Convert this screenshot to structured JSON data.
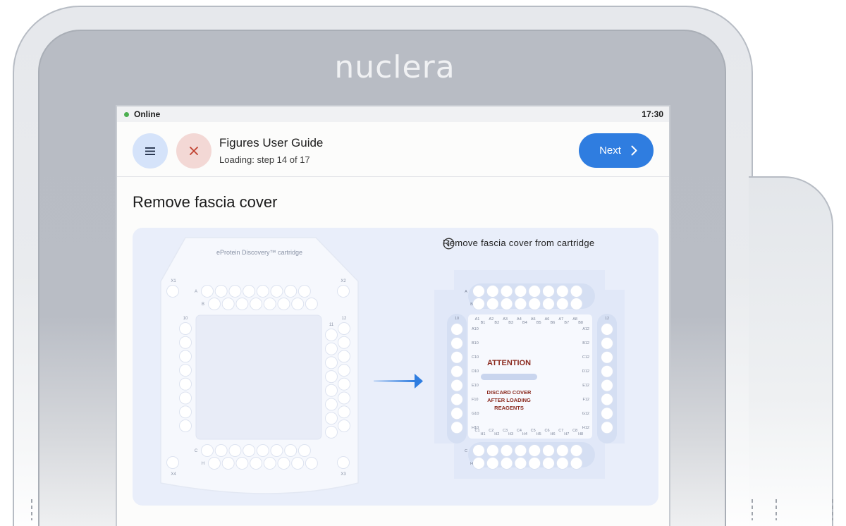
{
  "device": {
    "brand": "nuclera"
  },
  "status_bar": {
    "connection": "Online",
    "time": "17:30"
  },
  "header": {
    "title": "Figures User Guide",
    "subtitle": "Loading: step 14 of 17",
    "next_label": "Next",
    "menu_icon": "menu-icon",
    "close_icon": "close-icon"
  },
  "step": {
    "title": "Remove fascia cover"
  },
  "figure": {
    "caption": "Remove fascia cover from cartridge",
    "left_cartridge": {
      "label": "eProtein Discovery™ cartridge",
      "corner_labels": [
        "X1",
        "X2",
        "X3",
        "X4"
      ],
      "row_labels": [
        "A",
        "B",
        "C",
        "H"
      ],
      "column_labels": [
        "10",
        "11",
        "12"
      ]
    },
    "right_cartridge": {
      "row_labels": [
        "A",
        "B",
        "C",
        "H"
      ],
      "side_labels": [
        "10",
        "12"
      ],
      "top_wells": [
        "A1",
        "B1",
        "A2",
        "B2",
        "A3",
        "B3",
        "A4",
        "B4",
        "A5",
        "B5",
        "A6",
        "B6",
        "A7",
        "B7",
        "A8",
        "B8"
      ],
      "left_wells": [
        "A10",
        "B10",
        "C10",
        "D10",
        "E10",
        "F10",
        "G10",
        "H10"
      ],
      "right_wells": [
        "A12",
        "B12",
        "C12",
        "D12",
        "E12",
        "F12",
        "G12",
        "H12"
      ],
      "bottom_wells": [
        "C1",
        "H1",
        "C2",
        "H2",
        "C3",
        "H3",
        "C4",
        "H4",
        "C5",
        "H5",
        "C6",
        "H6",
        "C7",
        "H7",
        "C8",
        "H8"
      ],
      "attention_title": "ATTENTION",
      "attention_lines": [
        "DISCARD COVER",
        "AFTER LOADING",
        "REAGENTS"
      ]
    },
    "colors": {
      "accent": "#2f7de0",
      "attention": "#8b2a1f",
      "online": "#4caf50"
    }
  }
}
